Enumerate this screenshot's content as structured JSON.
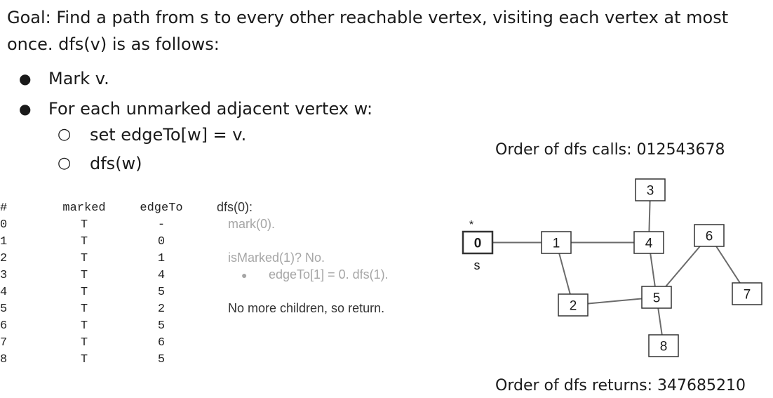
{
  "goal_text": "Goal: Find a path from s to every other reachable vertex, visiting each vertex at most once. dfs(v) is as follows:",
  "bullets": [
    {
      "marker": "●",
      "text": "Mark v."
    },
    {
      "marker": "●",
      "text": "For each unmarked adjacent vertex w:"
    },
    {
      "marker": "○",
      "text": "set edgeTo[w] = v."
    },
    {
      "marker": "○",
      "text": "dfs(w)"
    }
  ],
  "table": {
    "headers": [
      "#",
      "marked",
      "edgeTo"
    ],
    "rows": [
      [
        "0",
        "T",
        "-"
      ],
      [
        "1",
        "T",
        "0"
      ],
      [
        "2",
        "T",
        "1"
      ],
      [
        "3",
        "T",
        "4"
      ],
      [
        "4",
        "T",
        "5"
      ],
      [
        "5",
        "T",
        "2"
      ],
      [
        "6",
        "T",
        "5"
      ],
      [
        "7",
        "T",
        "6"
      ],
      [
        "8",
        "T",
        "5"
      ]
    ]
  },
  "trace": {
    "call": "dfs(0):",
    "mark": "mark(0).",
    "check": "isMarked(1)? No.",
    "bullet_marker": "●",
    "bullet": "edgeTo[1] = 0. dfs(1).",
    "done": "No more children, so return."
  },
  "order_calls": "Order of dfs calls: 012543678",
  "order_returns": "Order of dfs returns: 347685210",
  "graph": {
    "source_star": "*",
    "source_label": "s",
    "nodes": [
      {
        "id": "0",
        "bold": true
      },
      {
        "id": "1"
      },
      {
        "id": "2"
      },
      {
        "id": "3"
      },
      {
        "id": "4"
      },
      {
        "id": "5"
      },
      {
        "id": "6"
      },
      {
        "id": "7"
      },
      {
        "id": "8"
      }
    ],
    "edges": [
      [
        "0",
        "1"
      ],
      [
        "1",
        "4"
      ],
      [
        "1",
        "2"
      ],
      [
        "3",
        "4"
      ],
      [
        "4",
        "5"
      ],
      [
        "2",
        "5"
      ],
      [
        "5",
        "6"
      ],
      [
        "6",
        "7"
      ],
      [
        "5",
        "8"
      ]
    ],
    "colors": {
      "edge": "#6b6b6b",
      "box": "#333333",
      "text": "#1a1a1a"
    }
  }
}
